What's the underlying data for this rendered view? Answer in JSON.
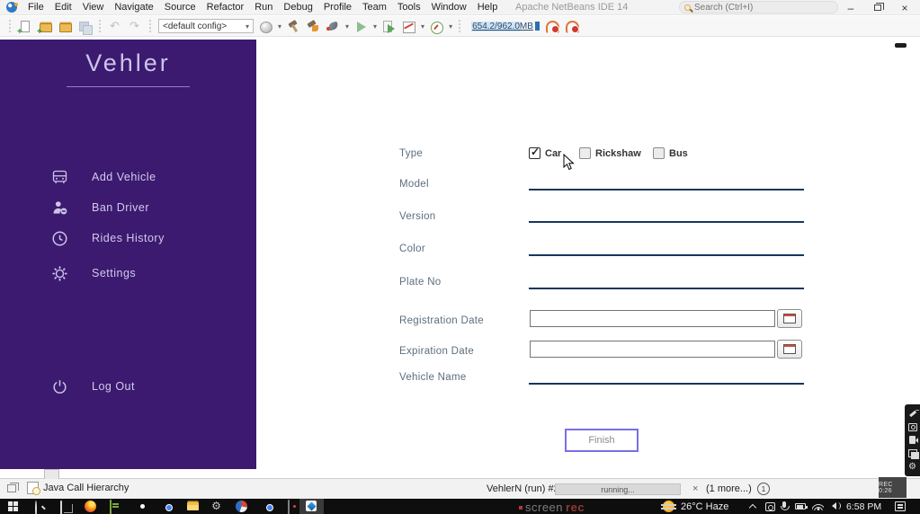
{
  "titlebar": {
    "menus": [
      "File",
      "Edit",
      "View",
      "Navigate",
      "Source",
      "Refactor",
      "Run",
      "Debug",
      "Profile",
      "Team",
      "Tools",
      "Window",
      "Help"
    ],
    "app_title": "Apache NetBeans IDE 14",
    "search_placeholder": "Search (Ctrl+I)",
    "window_controls": {
      "minimize": "–",
      "close": "×"
    }
  },
  "toolbar": {
    "config_dropdown_value": "<default config>",
    "memory_indicator": "654.2/962.0MB",
    "icons": [
      "new-file",
      "new-project",
      "open-project",
      "save-all",
      "undo",
      "redo",
      "deploy",
      "build-project",
      "clean-and-build",
      "debug-project",
      "run-project",
      "rerun",
      "profile-project",
      "profile-gauge",
      "profiler-1",
      "profiler-2"
    ]
  },
  "app": {
    "sidebar": {
      "title": "Vehler",
      "items": [
        {
          "label": "Add Vehicle",
          "icon": "vehicle-icon"
        },
        {
          "label": "Ban Driver",
          "icon": "ban-driver-icon"
        },
        {
          "label": "Rides History",
          "icon": "history-icon"
        },
        {
          "label": "Settings",
          "icon": "settings-icon"
        }
      ],
      "logout": {
        "label": "Log Out",
        "icon": "power-icon"
      }
    },
    "form": {
      "type_label": "Type",
      "type_options": [
        {
          "label": "Car",
          "checked": true
        },
        {
          "label": "Rickshaw",
          "checked": false
        },
        {
          "label": "Bus",
          "checked": false
        }
      ],
      "fields": [
        {
          "label": "Model",
          "value": "",
          "type": "underline"
        },
        {
          "label": "Version",
          "value": "",
          "type": "underline"
        },
        {
          "label": "Color",
          "value": "",
          "type": "underline"
        },
        {
          "label": "Plate No",
          "value": "",
          "type": "underline"
        },
        {
          "label": "Registration Date",
          "value": "",
          "type": "date"
        },
        {
          "label": "Expiration Date",
          "value": "",
          "type": "date"
        },
        {
          "label": "Vehicle Name",
          "value": "",
          "type": "underline"
        }
      ],
      "finish_button": "Finish"
    }
  },
  "statusbar": {
    "left_tab": "Java Call Hierarchy",
    "task_name": "VehlerN (run) #2",
    "progress_text": "running...",
    "close_glyph": "×",
    "more_tasks": "(1 more...)",
    "badge_count": "1"
  },
  "taskbar": {
    "icons": [
      "start",
      "search",
      "task-view",
      "firefox",
      "notepad",
      "screenrec",
      "chrome",
      "file-explorer",
      "settings",
      "browser-ball",
      "chrome-2",
      "monitor",
      "netbeans-app"
    ],
    "watermark": {
      "part1": "screen",
      "part2": "rec"
    },
    "tray": {
      "weather": "26°C Haze",
      "time": "6:58 PM"
    }
  },
  "screenrec": {
    "timer": "REC 0:26"
  },
  "colors": {
    "sidebar_purple": "#3b1a70",
    "accent_lavender": "#cdc4e9",
    "field_underline": "#16365d",
    "finish_border": "#7a6fe2"
  }
}
